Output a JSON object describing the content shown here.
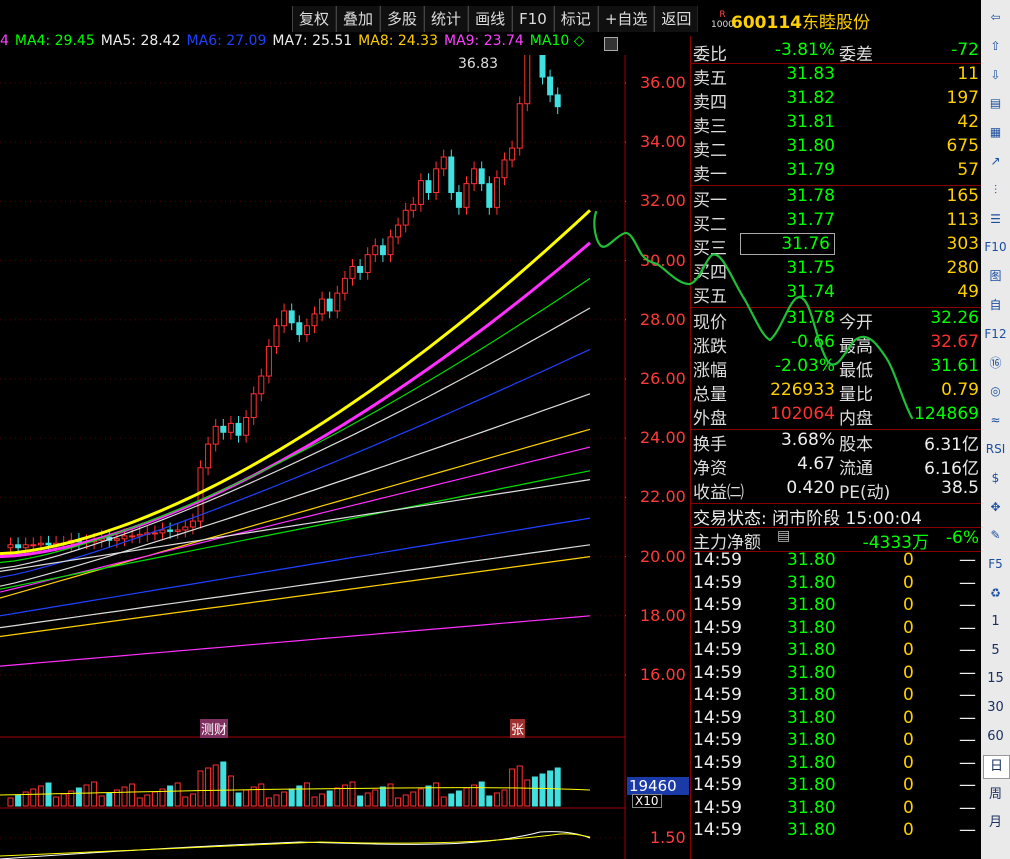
{
  "toolbar": {
    "items": [
      "复权",
      "叠加",
      "多股",
      "统计",
      "画线",
      "F10",
      "标记",
      "+自选",
      "返回"
    ]
  },
  "stock": {
    "badge_top": "R",
    "badge_bottom": "1000",
    "code": "600114",
    "name": "东睦股份"
  },
  "ma_bar": [
    {
      "label": "4",
      "color": "#ff40ff"
    },
    {
      "label": "MA4: 29.45",
      "color": "#00ff00"
    },
    {
      "label": "MA5: 28.42",
      "color": "#eeeeee"
    },
    {
      "label": "MA6: 27.09",
      "color": "#2040ff"
    },
    {
      "label": "MA7: 25.51",
      "color": "#eeeeee"
    },
    {
      "label": "MA8: 24.33",
      "color": "#ffd000"
    },
    {
      "label": "MA9: 23.74",
      "color": "#ff40ff"
    },
    {
      "label": "MA10 ◇",
      "color": "#00ff00"
    }
  ],
  "price_axis": [
    "36.00",
    "34.00",
    "32.00",
    "30.00",
    "28.00",
    "26.00",
    "24.00",
    "22.00",
    "20.00",
    "18.00",
    "16.00"
  ],
  "peak_label": "36.83",
  "markers": {
    "news": "测财",
    "limit": "张"
  },
  "volume": {
    "value_box": "19460",
    "unit": "X10",
    "sub_tick": "1.50"
  },
  "quote": {
    "weibi_label": "委比",
    "weibi": "-3.81%",
    "weicha_label": "委差",
    "weicha": "-72",
    "asks": [
      {
        "label": "卖五",
        "price": "31.83",
        "vol": "11"
      },
      {
        "label": "卖四",
        "price": "31.82",
        "vol": "197"
      },
      {
        "label": "卖三",
        "price": "31.81",
        "vol": "42"
      },
      {
        "label": "卖二",
        "price": "31.80",
        "vol": "675"
      },
      {
        "label": "卖一",
        "price": "31.79",
        "vol": "57"
      }
    ],
    "bids": [
      {
        "label": "买一",
        "price": "31.78",
        "vol": "165"
      },
      {
        "label": "买二",
        "price": "31.77",
        "vol": "113"
      },
      {
        "label": "买三",
        "price": "31.76",
        "vol": "303"
      },
      {
        "label": "买四",
        "price": "31.75",
        "vol": "280"
      },
      {
        "label": "买五",
        "price": "31.74",
        "vol": "49"
      }
    ],
    "stats": [
      {
        "l1": "现价",
        "v1": "31.78",
        "c1": "green",
        "l2": "今开",
        "v2": "32.26",
        "c2": "green"
      },
      {
        "l1": "涨跌",
        "v1": "-0.66",
        "c1": "green",
        "l2": "最高",
        "v2": "32.67",
        "c2": "red"
      },
      {
        "l1": "涨幅",
        "v1": "-2.03%",
        "c1": "green",
        "l2": "最低",
        "v2": "31.61",
        "c2": "green"
      },
      {
        "l1": "总量",
        "v1": "226933",
        "c1": "yellow",
        "l2": "量比",
        "v2": "0.79",
        "c2": "yellow"
      },
      {
        "l1": "外盘",
        "v1": "102064",
        "c1": "red",
        "l2": "内盘",
        "v2": "124869",
        "c2": "green"
      }
    ],
    "fundamentals": [
      {
        "l1": "换手",
        "v1": "3.68%",
        "l2": "股本",
        "v2": "6.31亿"
      },
      {
        "l1": "净资",
        "v1": "4.67",
        "l2": "流通",
        "v2": "6.16亿"
      },
      {
        "l1": "收益㈡",
        "v1": "0.420",
        "l2": "PE(动)",
        "v2": "38.5"
      }
    ],
    "trade_status": "交易状态: 闭市阶段 15:00:04",
    "main_flow_label": "主力净额",
    "main_flow_value": "-4333万",
    "main_flow_pct": "-6%"
  },
  "ticks": [
    {
      "time": "14:59",
      "price": "31.80",
      "vol": "0",
      "flag": "—"
    },
    {
      "time": "14:59",
      "price": "31.80",
      "vol": "0",
      "flag": "—"
    },
    {
      "time": "14:59",
      "price": "31.80",
      "vol": "0",
      "flag": "—"
    },
    {
      "time": "14:59",
      "price": "31.80",
      "vol": "0",
      "flag": "—"
    },
    {
      "time": "14:59",
      "price": "31.80",
      "vol": "0",
      "flag": "—"
    },
    {
      "time": "14:59",
      "price": "31.80",
      "vol": "0",
      "flag": "—"
    },
    {
      "time": "14:59",
      "price": "31.80",
      "vol": "0",
      "flag": "—"
    },
    {
      "time": "14:59",
      "price": "31.80",
      "vol": "0",
      "flag": "—"
    },
    {
      "time": "14:59",
      "price": "31.80",
      "vol": "0",
      "flag": "—"
    },
    {
      "time": "14:59",
      "price": "31.80",
      "vol": "0",
      "flag": "—"
    },
    {
      "time": "14:59",
      "price": "31.80",
      "vol": "0",
      "flag": "—"
    },
    {
      "time": "14:59",
      "price": "31.80",
      "vol": "0",
      "flag": "—"
    },
    {
      "time": "14:59",
      "price": "31.80",
      "vol": "0",
      "flag": "—"
    }
  ],
  "sidebar": [
    "⇦",
    "⇧",
    "⇩",
    "▤",
    "▦",
    "↗",
    "⫶",
    "☰",
    "F10",
    "图",
    "自",
    "F12",
    "⑯",
    "◎",
    "≈",
    "RSI",
    "$",
    "✥",
    "✎",
    "F5",
    "♻",
    "1",
    "5",
    "15",
    "30",
    "60",
    "日",
    "周",
    "月"
  ]
}
